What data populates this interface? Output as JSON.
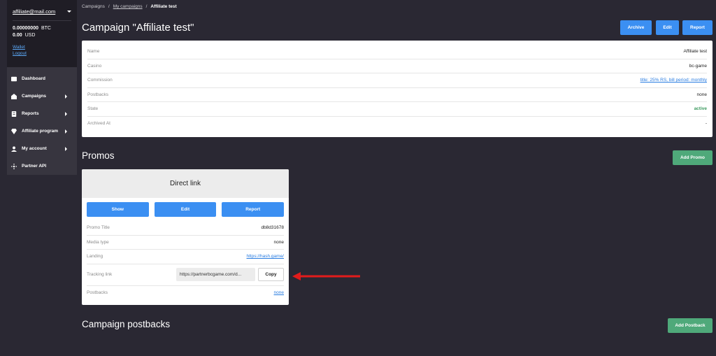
{
  "sidebar": {
    "account_email": "affiliate@mail.com",
    "balance_btc_value": "0.00000000",
    "balance_btc_unit": "BTC",
    "balance_usd_value": "0.00",
    "balance_usd_unit": "USD",
    "wallet_label": "Wallet",
    "logout_label": "Logout",
    "items": [
      {
        "label": "Dashboard",
        "icon": "dashboard-icon"
      },
      {
        "label": "Campaigns",
        "icon": "campaigns-icon"
      },
      {
        "label": "Reports",
        "icon": "reports-icon"
      },
      {
        "label": "Affiliate program",
        "icon": "diamond-icon"
      },
      {
        "label": "My account",
        "icon": "user-icon"
      },
      {
        "label": "Partner API",
        "icon": "api-icon"
      }
    ]
  },
  "breadcrumb": {
    "a": "Campaigns",
    "b": "My campaigns",
    "c": "Affiliate test",
    "sep": "/"
  },
  "header": {
    "title": "Campaign \"Affiliate test\"",
    "archive": "Archive",
    "edit": "Edit",
    "report": "Report"
  },
  "campaign": {
    "rows": [
      {
        "k": "Name",
        "v": "Affiliate test"
      },
      {
        "k": "Casino",
        "v": "bc-game"
      },
      {
        "k": "Commission",
        "v": "title: 25% RS, bill period: monthly"
      },
      {
        "k": "Postbacks",
        "v": "none"
      },
      {
        "k": "State",
        "v": "active"
      },
      {
        "k": "Archived At",
        "v": "-"
      }
    ]
  },
  "promos": {
    "title": "Promos",
    "add": "Add Promo",
    "card": {
      "head": "Direct link",
      "show": "Show",
      "edit": "Edit",
      "report": "Report",
      "promo_title_k": "Promo Title",
      "promo_title_v": "db8d31678",
      "media_k": "Media type",
      "media_v": "none",
      "landing_k": "Landing",
      "landing_v": "https://hash.game/",
      "tracking_k": "Tracking link",
      "tracking_v": "https://partnerbcgame.com/d...",
      "copy": "Copy",
      "postbacks_k": "Postbacks",
      "postbacks_v": "none"
    }
  },
  "postbacks": {
    "title": "Campaign postbacks",
    "add": "Add Postback"
  },
  "colors": {
    "accent": "#3b8ff2",
    "success": "#4fa97a",
    "annotation_arrow": "#e11b1b"
  }
}
